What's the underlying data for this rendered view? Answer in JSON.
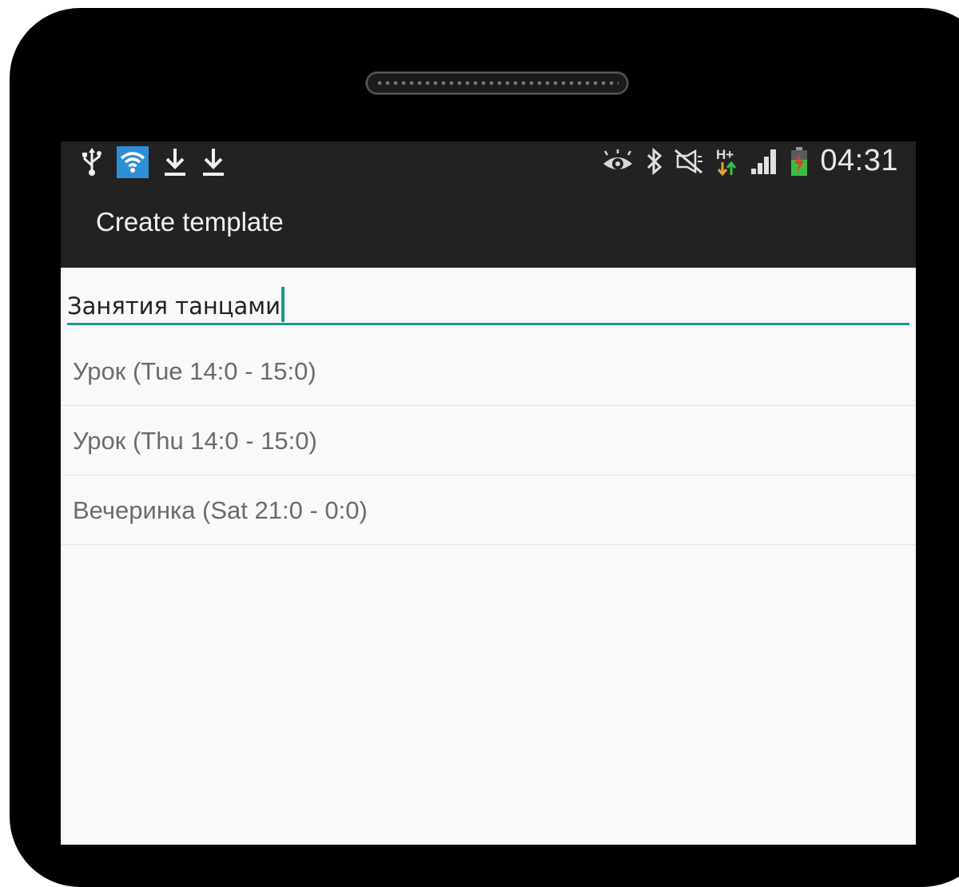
{
  "statusbar": {
    "icons_left": [
      "usb-icon",
      "wifi-icon",
      "download-icon",
      "download-icon"
    ],
    "icons_right": [
      "eye-icon",
      "bluetooth-icon",
      "mute-icon",
      "hplus-data-icon",
      "signal-icon",
      "battery-icon"
    ],
    "time": "04:31"
  },
  "actionbar": {
    "title": "Create template"
  },
  "template_name": {
    "value": "Занятия танцами"
  },
  "events": [
    {
      "label": "Урок (Tue 14:0 - 15:0)"
    },
    {
      "label": "Урок (Thu 14:0 - 15:0)"
    },
    {
      "label": "Вечеринка (Sat 21:0 - 0:0)"
    }
  ],
  "colors": {
    "accent": "#18998d",
    "bar": "#222222",
    "background": "#f9f9f9",
    "wifi_bg": "#2d8fd5"
  }
}
